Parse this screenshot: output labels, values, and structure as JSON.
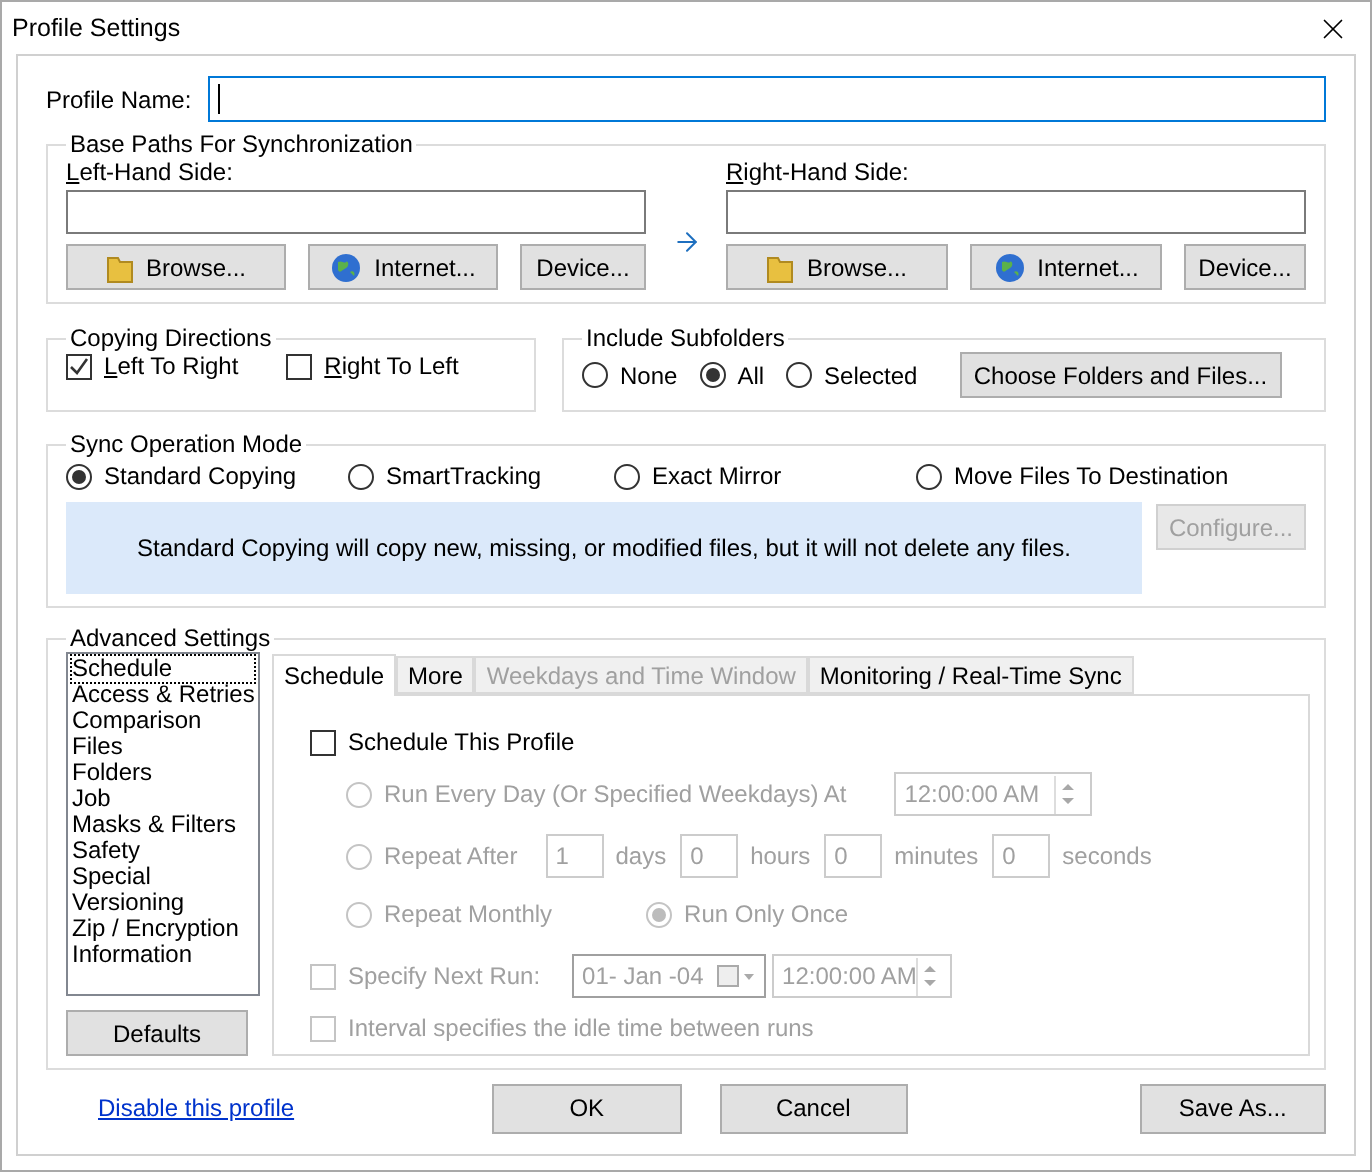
{
  "window": {
    "title": "Profile Settings"
  },
  "profile_name": {
    "label": "Profile Name:",
    "focused": true
  },
  "base_paths": {
    "title": "Base Paths For Synchronization",
    "sides": [
      {
        "label_key": "L",
        "label_rest": "eft-Hand Side:",
        "buttons": [
          {
            "label": "Browse..."
          },
          {
            "label": "Internet..."
          },
          {
            "label": "Device..."
          }
        ]
      },
      {
        "label_key": "R",
        "label_rest": "ight-Hand Side:",
        "buttons": [
          {
            "label": "Browse..."
          },
          {
            "label": "Internet..."
          },
          {
            "label": "Device..."
          }
        ]
      }
    ]
  },
  "copying_directions": {
    "title": "Copying Directions",
    "options": [
      {
        "label_key": "L",
        "label_rest": "eft To Right",
        "checked": true
      },
      {
        "label_key": "R",
        "label_rest": "ight To Left",
        "checked": false
      }
    ]
  },
  "include_subfolders": {
    "title": "Include Subfolders",
    "options": [
      {
        "label": "None",
        "selected": false
      },
      {
        "label": "All",
        "selected": true
      },
      {
        "label": "Selected",
        "selected": false
      }
    ],
    "button": "Choose Folders and Files..."
  },
  "sync_mode": {
    "title": "Sync Operation Mode",
    "options": [
      {
        "label": "Standard Copying",
        "selected": true
      },
      {
        "label": "SmartTracking",
        "selected": false
      },
      {
        "label": "Exact Mirror",
        "selected": false
      },
      {
        "label": "Move Files To Destination",
        "selected": false
      }
    ],
    "description": "Standard Copying will copy new, missing, or modified files, but it will not delete any files.",
    "configure": {
      "label": "Configure...",
      "disabled": true
    }
  },
  "advanced": {
    "title": "Advanced Settings",
    "categories": [
      {
        "label": "Schedule",
        "selected": true
      },
      {
        "label": "Access & Retries",
        "selected": false
      },
      {
        "label": "Comparison",
        "selected": false
      },
      {
        "label": "Files",
        "selected": false
      },
      {
        "label": "Folders",
        "selected": false
      },
      {
        "label": "Job",
        "selected": false
      },
      {
        "label": "Masks & Filters",
        "selected": false
      },
      {
        "label": "Safety",
        "selected": false
      },
      {
        "label": "Special",
        "selected": false
      },
      {
        "label": "Versioning",
        "selected": false
      },
      {
        "label": "Zip / Encryption",
        "selected": false
      },
      {
        "label": "Information",
        "selected": false
      }
    ],
    "defaults_button": "Defaults",
    "tabs": [
      {
        "label": "Schedule",
        "selected": true,
        "disabled": false
      },
      {
        "label": "More",
        "selected": false,
        "disabled": false
      },
      {
        "label": "Weekdays and Time Window",
        "selected": false,
        "disabled": true
      },
      {
        "label": "Monitoring / Real-Time Sync",
        "selected": false,
        "disabled": false
      }
    ],
    "schedule": {
      "disabled": true,
      "enable": {
        "label": "Schedule This Profile",
        "checked": false
      },
      "rows": [
        {
          "kind": "daily",
          "label": "Run Every Day (Or Specified Weekdays) At",
          "selected": false,
          "time": "12:00:00 AM"
        },
        {
          "kind": "interval",
          "label": "Repeat After",
          "selected": false,
          "fields": [
            {
              "value": "1",
              "unit": "days"
            },
            {
              "value": "0",
              "unit": "hours"
            },
            {
              "value": "0",
              "unit": "minutes"
            },
            {
              "value": "0",
              "unit": "seconds"
            }
          ]
        },
        {
          "kind": "monthly",
          "label": "Repeat Monthly",
          "selected": false,
          "extra": {
            "label": "Run Only Once",
            "selected": true
          }
        }
      ],
      "next_run": {
        "label": "Specify Next Run:",
        "checked": false,
        "date": "01- Jan -04",
        "time": "12:00:00 AM"
      },
      "idle": {
        "label": "Interval specifies the idle time between runs",
        "checked": false
      }
    }
  },
  "footer": {
    "link": "Disable this profile",
    "buttons": [
      {
        "label": "OK"
      },
      {
        "label": "Cancel"
      },
      {
        "label": "Save As..."
      }
    ]
  }
}
